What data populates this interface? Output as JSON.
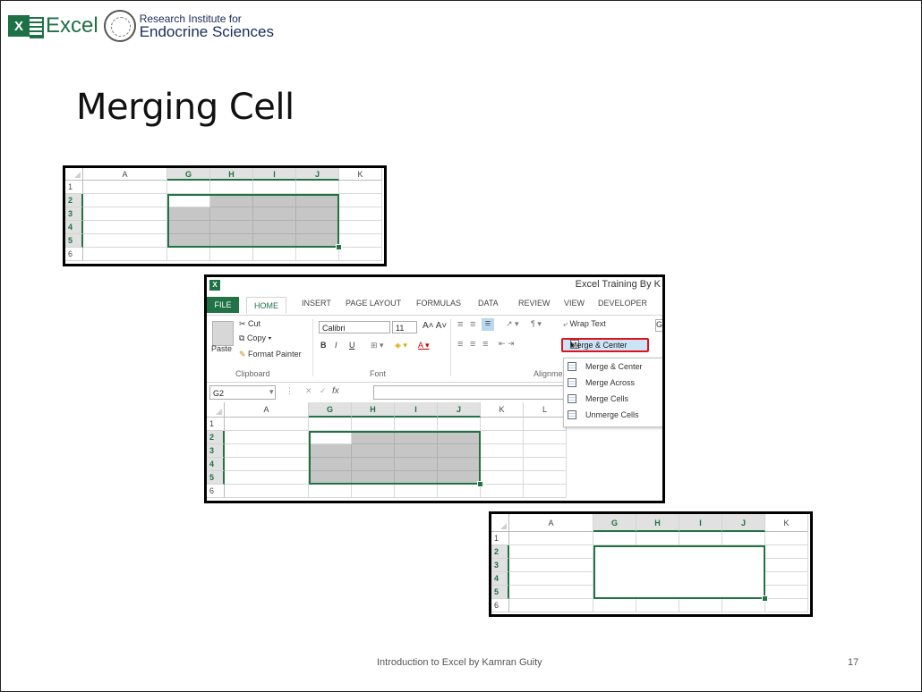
{
  "logo": {
    "excel_word": "Excel",
    "institute_line1": "Research Institute for",
    "institute_line2": "Endocrine Sciences"
  },
  "slide": {
    "title": "Merging Cell",
    "footer": "Introduction to Excel by Kamran Guity",
    "page_number": "17"
  },
  "grid_columns": [
    "A",
    "G",
    "H",
    "I",
    "J",
    "K"
  ],
  "grid_rows": [
    "1",
    "2",
    "3",
    "4",
    "5",
    "6"
  ],
  "excel_window": {
    "app_icon": "X",
    "window_title": "Excel Training By K",
    "tabs": [
      "FILE",
      "HOME",
      "INSERT",
      "PAGE LAYOUT",
      "FORMULAS",
      "DATA",
      "REVIEW",
      "VIEW",
      "DEVELOPER"
    ],
    "clipboard": {
      "paste": "Paste",
      "cut": "Cut",
      "copy": "Copy",
      "format_painter": "Format Painter",
      "group_label": "Clipboard"
    },
    "font": {
      "name": "Calibri",
      "size": "11",
      "group_label": "Font",
      "bold": "B",
      "italic": "I",
      "underline": "U"
    },
    "alignment": {
      "wrap_text": "Wrap Text",
      "merge_center": "Merge & Center",
      "group_label": "Alignment"
    },
    "merge_menu": [
      "Merge & Center",
      "Merge Across",
      "Merge Cells",
      "Unmerge Cells"
    ],
    "name_box": "G2",
    "fx": "fx",
    "columns": [
      "A",
      "G",
      "H",
      "I",
      "J",
      "K",
      "L"
    ],
    "rows": [
      "1",
      "2",
      "3",
      "4",
      "5",
      "6"
    ]
  },
  "colors": {
    "excel_green": "#217346",
    "selection_gray": "#c6c6c6",
    "highlight_red": "#e0121a"
  }
}
